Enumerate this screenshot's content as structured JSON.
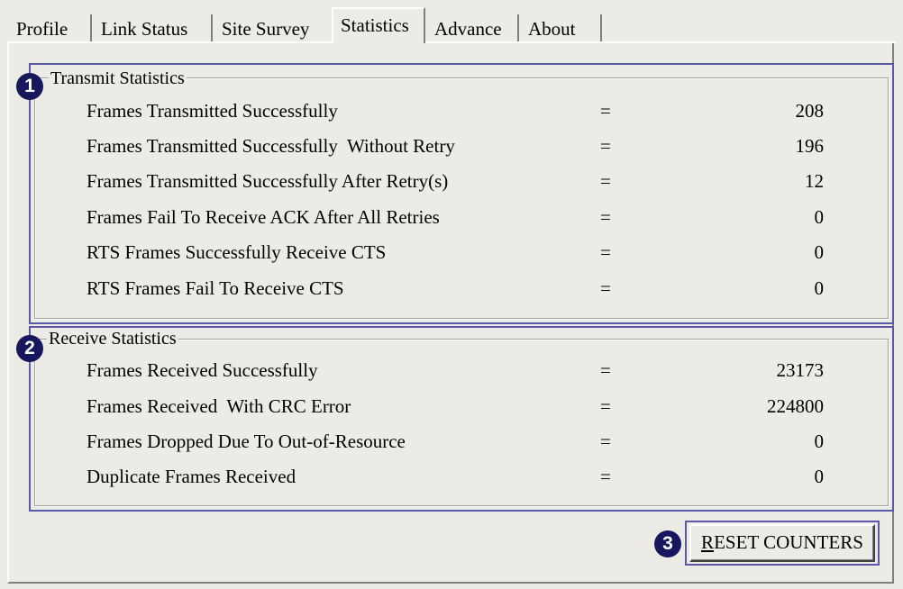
{
  "tabs": [
    {
      "label": "Profile",
      "selected": false
    },
    {
      "label": "Link Status",
      "selected": false
    },
    {
      "label": "Site Survey",
      "selected": false
    },
    {
      "label": "Statistics",
      "selected": true
    },
    {
      "label": "Advance",
      "selected": false
    },
    {
      "label": "About",
      "selected": false
    }
  ],
  "transmit": {
    "badge": "1",
    "title": "Transmit Statistics",
    "rows": [
      {
        "label": "Frames Transmitted Successfully",
        "eq": "=",
        "value": "208"
      },
      {
        "label": "Frames Transmitted Successfully  Without Retry",
        "eq": "=",
        "value": "196"
      },
      {
        "label": "Frames Transmitted Successfully After Retry(s)",
        "eq": "=",
        "value": "12"
      },
      {
        "label": "Frames Fail To Receive ACK After All Retries",
        "eq": "=",
        "value": "0"
      },
      {
        "label": "RTS Frames Successfully Receive CTS",
        "eq": "=",
        "value": "0"
      },
      {
        "label": "RTS Frames Fail To Receive CTS",
        "eq": "=",
        "value": "0"
      }
    ]
  },
  "receive": {
    "badge": "2",
    "title": "Receive Statistics",
    "rows": [
      {
        "label": "Frames Received Successfully",
        "eq": "=",
        "value": "23173"
      },
      {
        "label": "Frames Received  With CRC Error",
        "eq": "=",
        "value": "224800"
      },
      {
        "label": "Frames Dropped Due To Out-of-Resource",
        "eq": "=",
        "value": "0"
      },
      {
        "label": "Duplicate Frames Received",
        "eq": "=",
        "value": "0"
      }
    ]
  },
  "reset": {
    "badge": "3",
    "accel": "R",
    "rest": "ESET COUNTERS"
  },
  "colors": {
    "background": "#ecebe6",
    "badge": "#17175e",
    "highlight_outline": "#5a5aa8"
  }
}
